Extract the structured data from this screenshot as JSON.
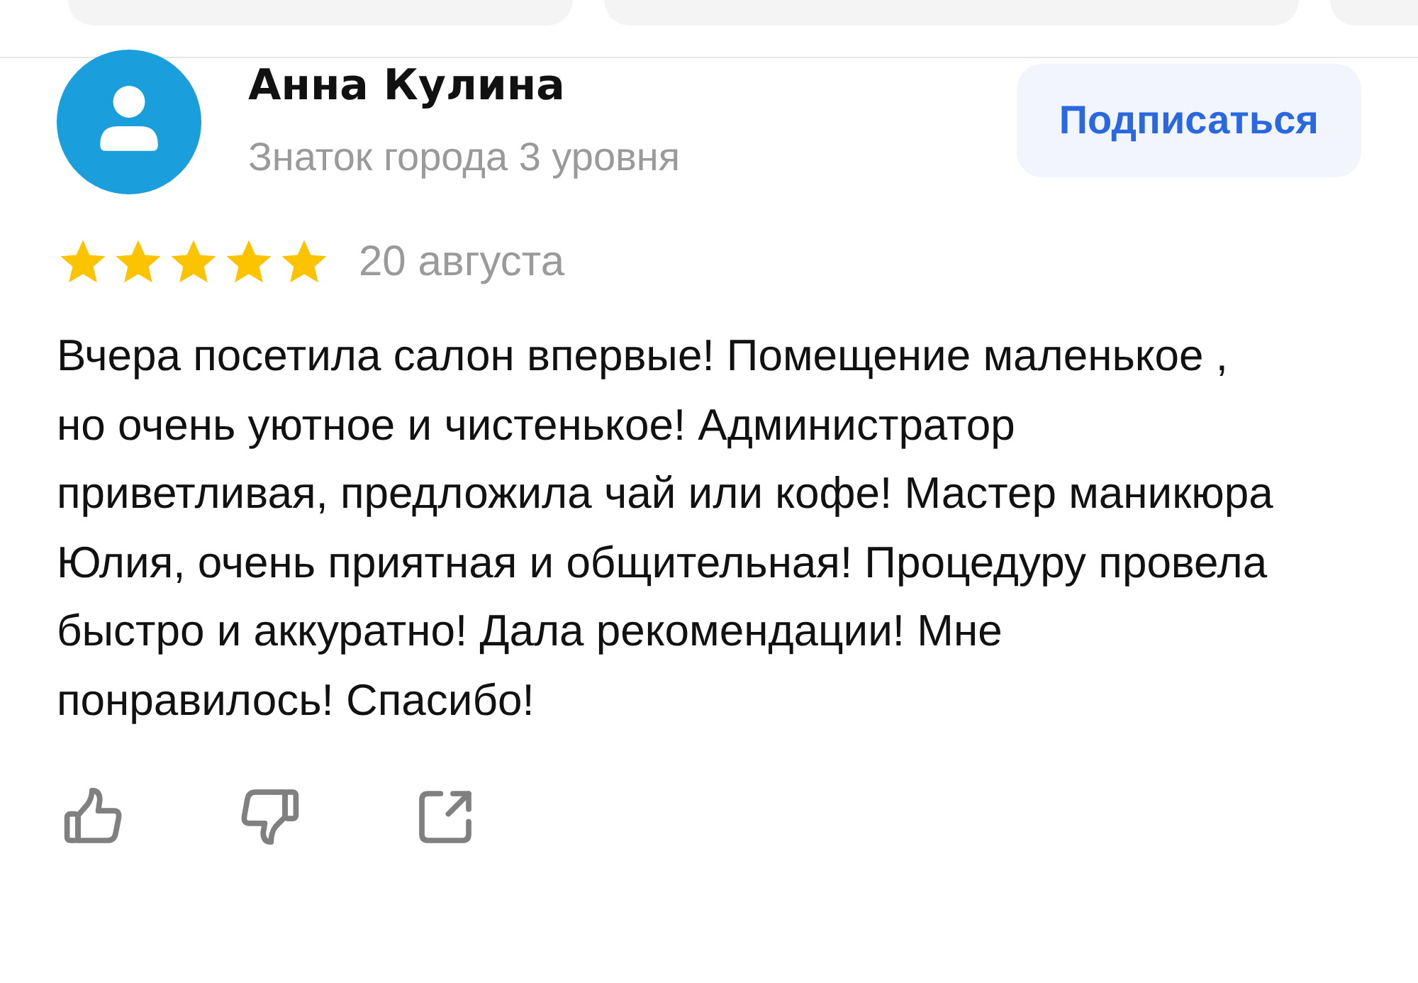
{
  "review": {
    "author": "Анна Кулина",
    "author_level": "Знаток города 3 уровня",
    "subscribe_button": "Подписаться",
    "stars": 5,
    "date": "20 августа",
    "text": "Вчера посетила салон впервые! Помещение маленькое , но очень уютное и чистенькое! Администратор приветливая, предложила чай или кофе! Мастер маникюра Юлия, очень приятная и общительная! Процедуру провела быстро и аккуратно! Дала рекомендации! Мне понравилось!  Спасибо!"
  }
}
